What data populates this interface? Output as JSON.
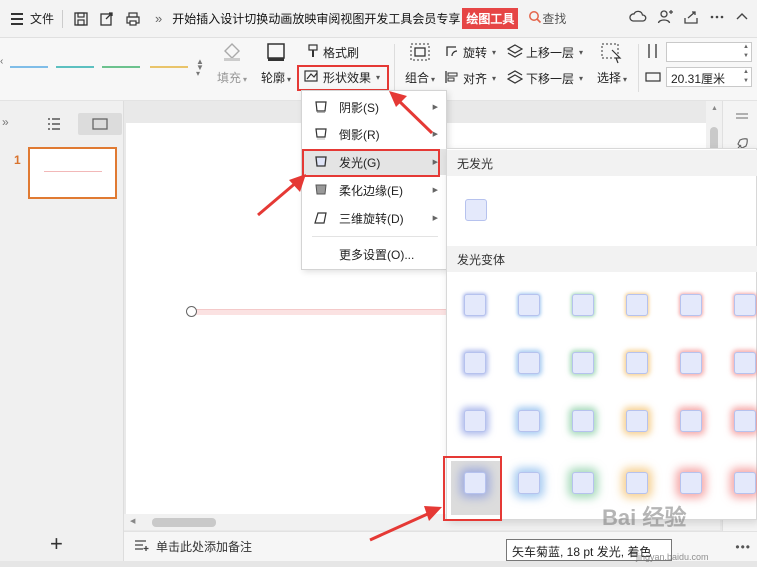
{
  "menubar": {
    "file_label": "文件",
    "more_glyph": "»",
    "tabs": [
      "开始",
      "插入",
      "设计",
      "切换",
      "动画",
      "放映",
      "审阅",
      "视图",
      " 开发工具",
      " 会员专享"
    ],
    "active_tab": "绘图工具",
    "search_label": "查找",
    "accent_color": "#e64545"
  },
  "ribbon": {
    "style_colors": [
      "#7fbde8",
      "#5cc0c0",
      "#6cc28e",
      "#e9c46a"
    ],
    "fill_label": "填充",
    "outline_label": "轮廓",
    "format_painter_label": "格式刷",
    "shape_effects_label": "形状效果",
    "rotate_label": "旋转",
    "group_label": "组合",
    "align_label": "对齐",
    "bring_forward_label": "上移一层",
    "send_backward_label": "下移一层",
    "select_label": "选择",
    "height_value": "",
    "width_value": "20.31厘米"
  },
  "leftpane": {
    "slide_number": "1",
    "add_glyph": "+"
  },
  "shape_effects_menu": {
    "items": [
      {
        "label": "阴影(S)",
        "has_sub": true
      },
      {
        "label": "倒影(R)",
        "has_sub": true
      },
      {
        "label": "发光(G)",
        "has_sub": true
      },
      {
        "label": "柔化边缘(E)",
        "has_sub": true
      },
      {
        "label": "三维旋转(D)",
        "has_sub": true
      },
      {
        "label": "更多设置(O)...",
        "has_sub": false
      }
    ]
  },
  "glow_menu": {
    "no_glow_header": "无发光",
    "variants_header": "发光变体",
    "glow_colors": [
      "#7b8fe0",
      "#6aa8e8",
      "#6cc28e",
      "#f0b04a",
      "#ef7070",
      "#ef7070"
    ],
    "rows": 4
  },
  "tooltip": {
    "text": "矢车菊蓝, 18 pt 发光, 着色"
  },
  "notes": {
    "placeholder": "单击此处添加备注",
    "more": "•••"
  },
  "watermark": {
    "text": "Bai 经验",
    "url": "jingyan.baidu.com"
  }
}
